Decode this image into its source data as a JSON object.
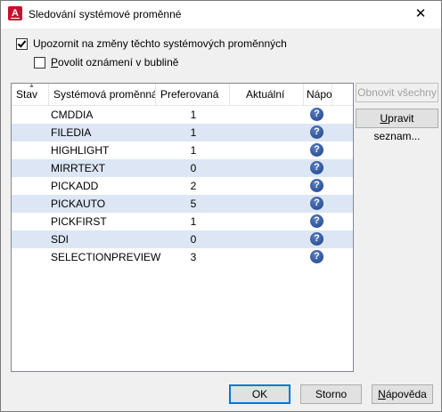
{
  "window": {
    "title": "Sledování systémové proměnné",
    "app_icon_letter": "A"
  },
  "options": {
    "notify_label": "Upozornit na změny těchto systémových proměnných",
    "notify_checked": true,
    "bubble_label_prefix": "",
    "bubble_label_accel": "P",
    "bubble_label_rest": "ovolit oznámení v bublině",
    "bubble_checked": false
  },
  "table": {
    "columns": [
      "Stav",
      "Systémová proměnná",
      "Preferovaná",
      "Aktuální",
      "Nápo"
    ],
    "rows": [
      {
        "name": "CMDDIA",
        "preferred": "1",
        "current": ""
      },
      {
        "name": "FILEDIA",
        "preferred": "1",
        "current": ""
      },
      {
        "name": "HIGHLIGHT",
        "preferred": "1",
        "current": ""
      },
      {
        "name": "MIRRTEXT",
        "preferred": "0",
        "current": ""
      },
      {
        "name": "PICKADD",
        "preferred": "2",
        "current": ""
      },
      {
        "name": "PICKAUTO",
        "preferred": "5",
        "current": ""
      },
      {
        "name": "PICKFIRST",
        "preferred": "1",
        "current": ""
      },
      {
        "name": "SDI",
        "preferred": "0",
        "current": ""
      },
      {
        "name": "SELECTIONPREVIEW",
        "preferred": "3",
        "current": ""
      }
    ],
    "help_glyph": "?"
  },
  "side_buttons": {
    "restore_all": "Obnovit všechny",
    "edit_list_accel": "U",
    "edit_list_rest": "pravit seznam..."
  },
  "footer": {
    "ok": "OK",
    "cancel": "Storno",
    "help_accel": "N",
    "help_rest": "ápověda"
  },
  "colors": {
    "accent": "#0078d7",
    "alt_row": "#dce6f4",
    "app_icon": "#c8102e"
  }
}
